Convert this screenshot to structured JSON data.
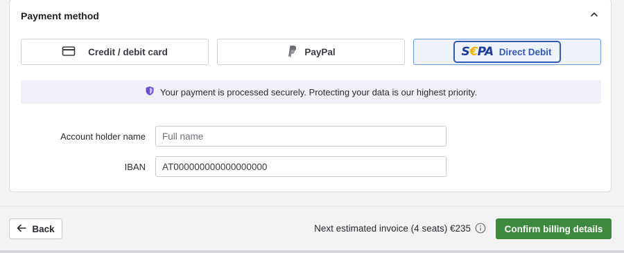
{
  "payment": {
    "section_title": "Payment method",
    "methods": [
      {
        "label": "Credit / debit card",
        "icon": "credit-card-icon",
        "selected": false
      },
      {
        "label": "PayPal",
        "icon": "paypal-icon",
        "selected": false
      },
      {
        "label": "Direct Debit",
        "icon": "sepa-logo",
        "logo_text": "SEPA",
        "selected": true
      }
    ],
    "security_notice": "Your payment is processed securely. Protecting your data is our highest priority.",
    "form": {
      "account_holder_label": "Account holder name",
      "account_holder_placeholder": "Full name",
      "account_holder_value": "",
      "iban_label": "IBAN",
      "iban_value": "AT000000000000000000"
    }
  },
  "footer": {
    "back_label": "Back",
    "invoice_text": "Next estimated invoice (4 seats) €235",
    "confirm_label": "Confirm billing details"
  },
  "colors": {
    "accent_blue": "#2f59b8",
    "confirm_green": "#3d8a3f",
    "notice_bg": "#f1f0f9",
    "shield_purple": "#6b4fd1"
  }
}
